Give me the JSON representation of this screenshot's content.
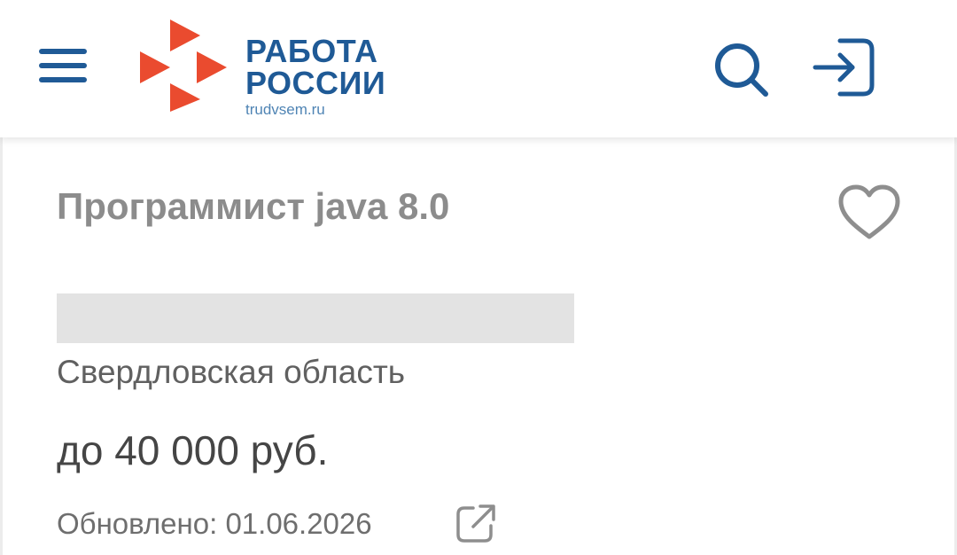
{
  "header": {
    "logo_line1": "РАБОТА",
    "logo_line2": "РОССИИ",
    "logo_domain": "trudvsem.ru",
    "menu_icon": "hamburger-menu-icon",
    "search_icon": "search-icon",
    "login_icon": "login-icon"
  },
  "vacancy": {
    "title": "Программист java 8.0",
    "employer": "",
    "region": "Свердловская область",
    "salary": "до 40 000 руб.",
    "updated": "Обновлено: 01.06.2026",
    "favorite_icon": "heart-icon",
    "share_icon": "external-link-icon"
  },
  "colors": {
    "brand_blue": "#1f5a96",
    "brand_red": "#ea4b2f",
    "title_gray": "#8c8c8c",
    "icon_gray": "#8e8e8e"
  }
}
